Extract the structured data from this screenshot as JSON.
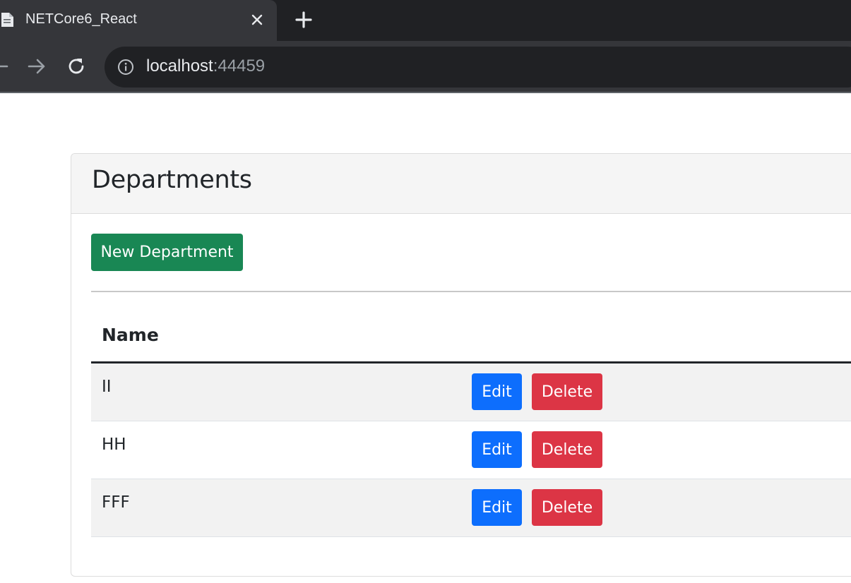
{
  "browser": {
    "tab_title": "NETCore6_React",
    "url_host": "localhost",
    "url_port": ":44459"
  },
  "card": {
    "title": "Departments",
    "new_button_label": "New Department"
  },
  "table": {
    "header_name": "Name",
    "rows": [
      {
        "name": "II",
        "edit_label": "Edit",
        "delete_label": "Delete"
      },
      {
        "name": "HH",
        "edit_label": "Edit",
        "delete_label": "Delete"
      },
      {
        "name": "FFF",
        "edit_label": "Edit",
        "delete_label": "Delete"
      }
    ]
  },
  "colors": {
    "success": "#198754",
    "primary": "#0d6efd",
    "danger": "#dc3545"
  },
  "icons": [
    "page-icon",
    "close-icon",
    "plus-icon",
    "back-arrow-icon",
    "forward-arrow-icon",
    "reload-icon",
    "info-icon"
  ]
}
